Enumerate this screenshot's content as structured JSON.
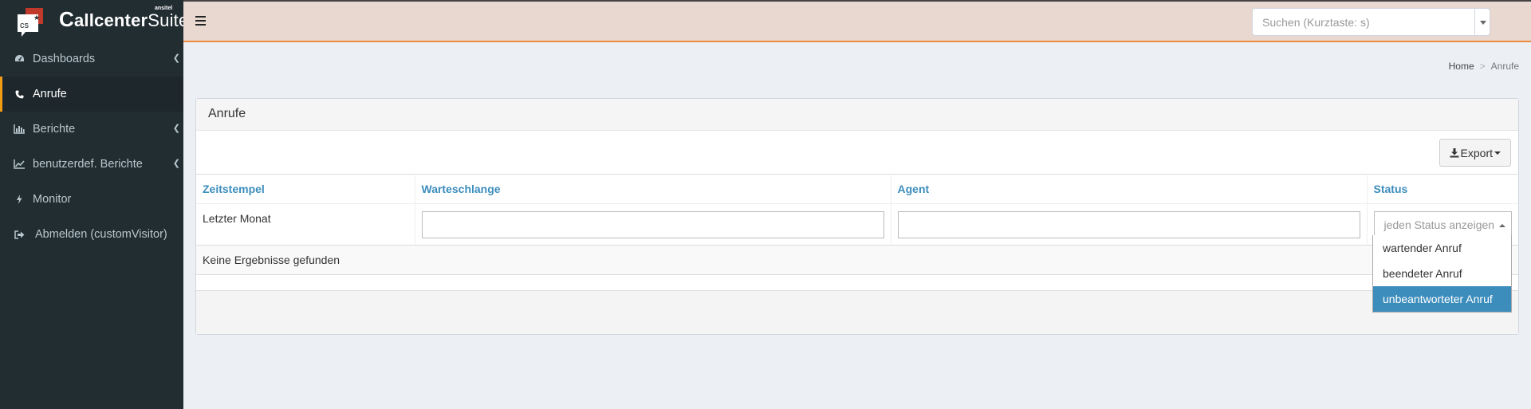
{
  "brand": {
    "mark": "cs",
    "name_first": "C",
    "name_bold": "allcenter",
    "name_light": "Suite",
    "sub": "ansitel",
    "accent": "#c0392b"
  },
  "sidebar": {
    "items": [
      {
        "label": "Dashboards",
        "icon": "dashboard-icon",
        "has_children": true
      },
      {
        "label": "Anrufe",
        "icon": "phone-icon",
        "active": true
      },
      {
        "label": "Berichte",
        "icon": "bar-chart-icon",
        "has_children": true
      },
      {
        "label": "benutzerdef. Berichte",
        "icon": "line-chart-icon",
        "has_children": true
      },
      {
        "label": "Monitor",
        "icon": "bolt-icon"
      },
      {
        "label": "Abmelden (customVisitor)",
        "icon": "sign-out-icon"
      }
    ]
  },
  "header": {
    "search_placeholder": "Suchen (Kurztaste: s)"
  },
  "breadcrumb": {
    "home": "Home",
    "separator": ">",
    "current": "Anrufe"
  },
  "box": {
    "title": "Anrufe",
    "export_label": "Export"
  },
  "table": {
    "columns": [
      "Zeitstempel",
      "Warteschlange",
      "Agent",
      "Status"
    ],
    "timestamp_filter": "Letzter Monat",
    "warteschlange_value": "",
    "agent_value": "",
    "status_placeholder": "jeden Status anzeigen",
    "empty_message": "Keine Ergebnisse gefunden"
  },
  "status_dropdown": {
    "options": [
      "wartender Anruf",
      "beendeter Anruf",
      "unbeantworteter Anruf"
    ],
    "highlighted": "unbeantworteter Anruf"
  },
  "colors": {
    "sidebar_bg": "#222d32",
    "header_bg": "#e8d8cf",
    "header_border": "#f08a3c",
    "active_marker": "#f39c12",
    "link_blue": "#3c8dbc"
  }
}
